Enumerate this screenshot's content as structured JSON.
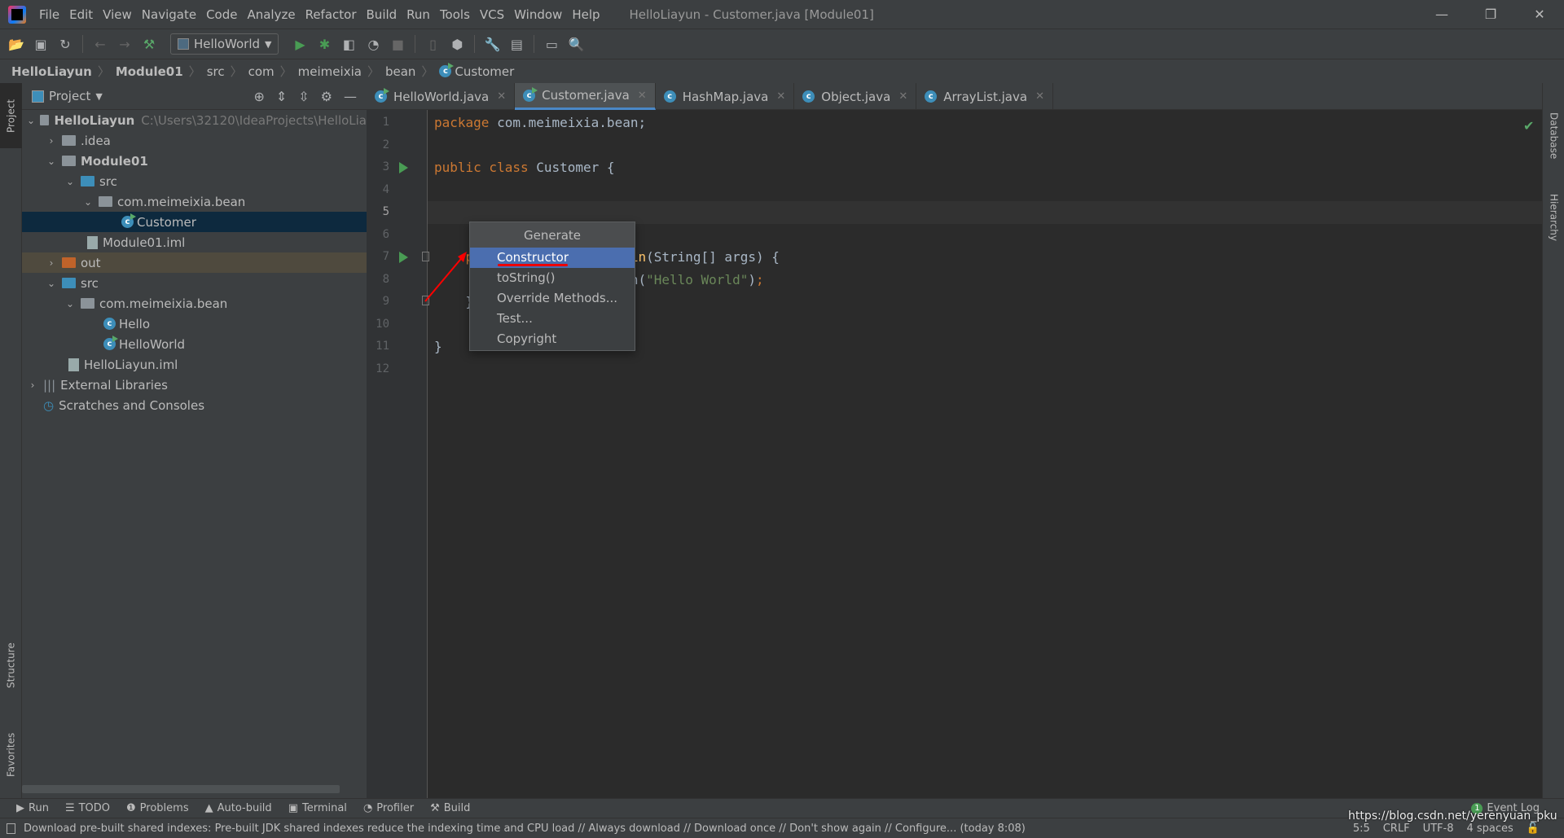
{
  "window": {
    "title": "HelloLiayun - Customer.java [Module01]",
    "minimize": "—",
    "restore": "❐",
    "close": "✕"
  },
  "menu": [
    "File",
    "Edit",
    "View",
    "Navigate",
    "Code",
    "Analyze",
    "Refactor",
    "Build",
    "Run",
    "Tools",
    "VCS",
    "Window",
    "Help"
  ],
  "toolbar": {
    "run_config": "HelloWorld"
  },
  "breadcrumb": [
    "HelloLiayun",
    "Module01",
    "src",
    "com",
    "meimeixia",
    "bean",
    "Customer"
  ],
  "left_stripe": {
    "project": "Project",
    "structure": "Structure",
    "favorites": "Favorites"
  },
  "right_stripe": {
    "database": "Database",
    "hierarchy": "Hierarchy"
  },
  "project_panel": {
    "title": "Project",
    "tree": [
      {
        "label": "HelloLiayun",
        "extra": "C:\\Users\\32120\\IdeaProjects\\HelloLia",
        "bold": true
      },
      {
        "label": ".idea"
      },
      {
        "label": "Module01",
        "bold": true
      },
      {
        "label": "src"
      },
      {
        "label": "com.meimeixia.bean"
      },
      {
        "label": "Customer"
      },
      {
        "label": "Module01.iml"
      },
      {
        "label": "out"
      },
      {
        "label": "src"
      },
      {
        "label": "com.meimeixia.bean"
      },
      {
        "label": "Hello"
      },
      {
        "label": "HelloWorld"
      },
      {
        "label": "HelloLiayun.iml"
      },
      {
        "label": "External Libraries"
      },
      {
        "label": "Scratches and Consoles"
      }
    ]
  },
  "tabs": [
    {
      "label": "HelloWorld.java"
    },
    {
      "label": "Customer.java",
      "active": true
    },
    {
      "label": "HashMap.java"
    },
    {
      "label": "Object.java"
    },
    {
      "label": "ArrayList.java"
    }
  ],
  "editor": {
    "line_numbers": [
      "1",
      "2",
      "3",
      "4",
      "5",
      "6",
      "7",
      "8",
      "9",
      "10",
      "11",
      "12"
    ],
    "current_line": 5
  },
  "popup": {
    "title": "Generate",
    "items": [
      "Constructor",
      "toString()",
      "Override Methods...",
      "Test...",
      "Copyright"
    ],
    "selected": "Constructor"
  },
  "bottom_tools": [
    "Run",
    "TODO",
    "Problems",
    "Auto-build",
    "Terminal",
    "Profiler",
    "Build"
  ],
  "event_log": {
    "count": "1",
    "label": "Event Log"
  },
  "status": {
    "message": "Download pre-built shared indexes: Pre-built JDK shared indexes reduce the indexing time and CPU load // Always download // Download once // Don't show again // Configure... (today 8:08)",
    "position": "5:5",
    "line_sep": "CRLF",
    "encoding": "UTF-8",
    "indent": "4 spaces"
  },
  "watermark": "https://blog.csdn.net/yerenyuan_pku",
  "colors": {
    "accent": "#4b6eaf",
    "keyword": "#cc7832",
    "string": "#6a8759",
    "function": "#ffc66d",
    "annotation_red": "#ff0000"
  }
}
